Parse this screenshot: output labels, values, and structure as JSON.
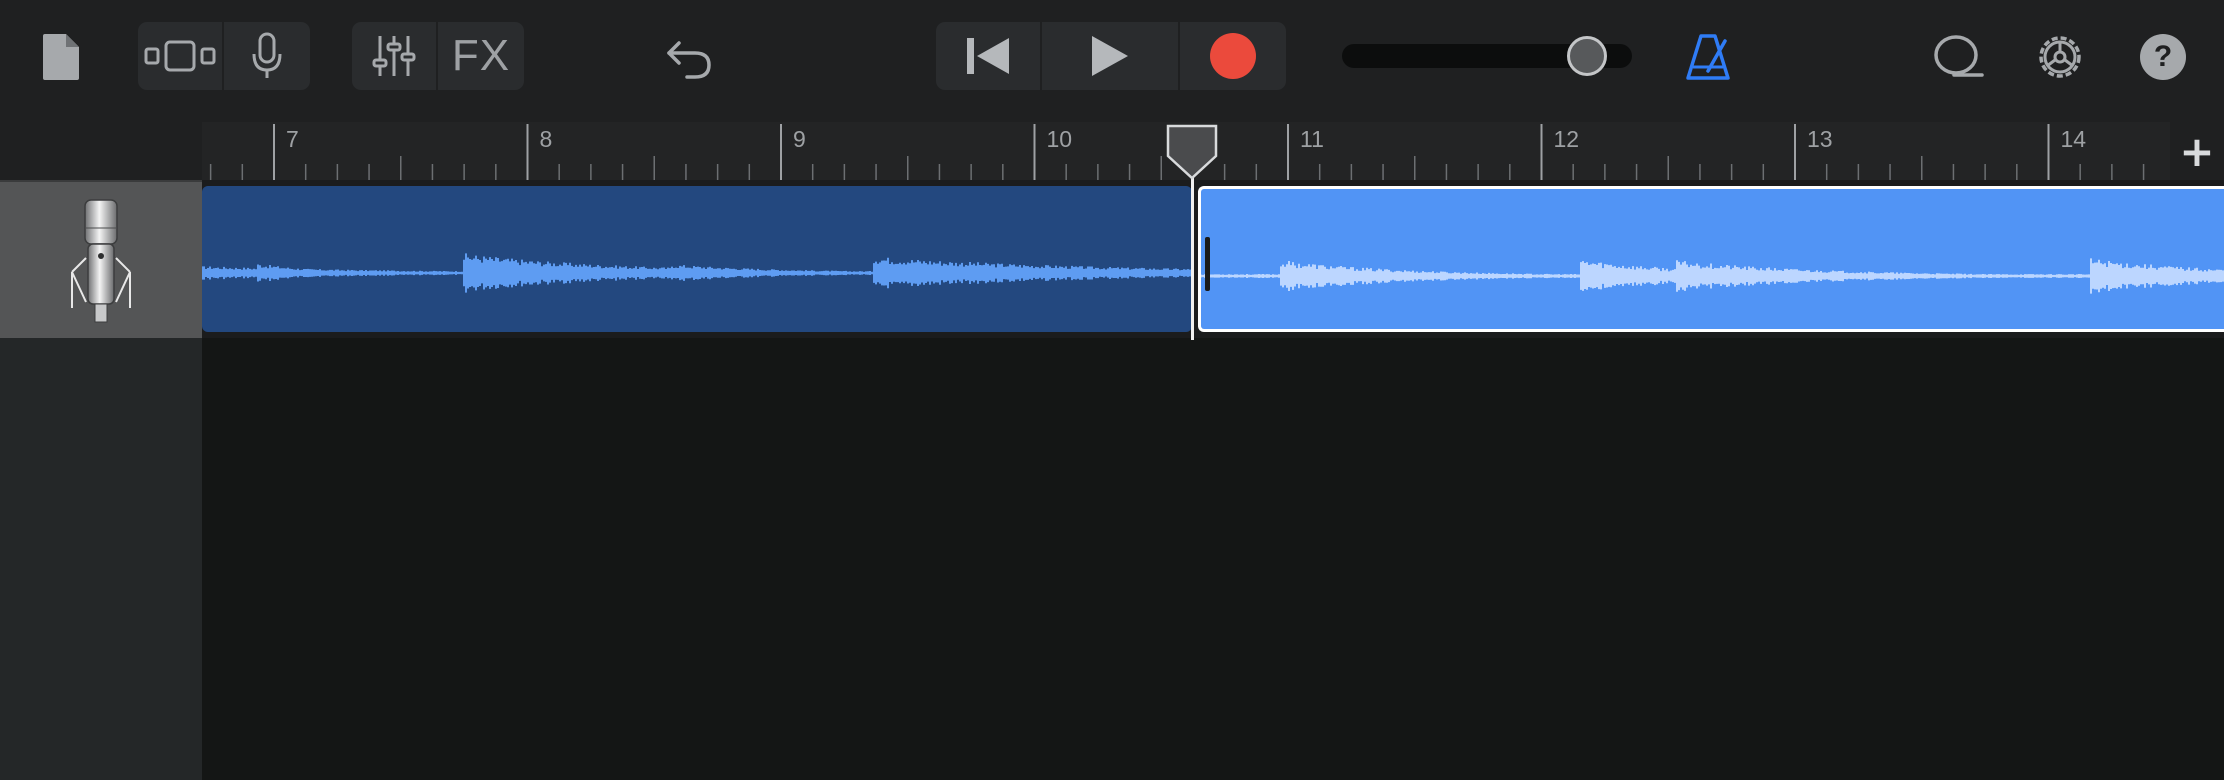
{
  "toolbar": {
    "fx_label": "FX",
    "help_label": "?",
    "volume_level": 0.9
  },
  "ruler": {
    "bars": [
      "7",
      "8",
      "9",
      "10",
      "11",
      "12",
      "13",
      "14"
    ]
  },
  "colors": {
    "record": "#eb4a3c",
    "metronome_active": "#2f7cf6",
    "region_dark": "#23487f",
    "region_selected": "#5194f5",
    "waveform_light": "#bcd6ff"
  },
  "tracks": [
    {
      "instrument_icon": "microphone-icon",
      "regions": [
        "region-1",
        "region-2-selected"
      ]
    }
  ]
}
